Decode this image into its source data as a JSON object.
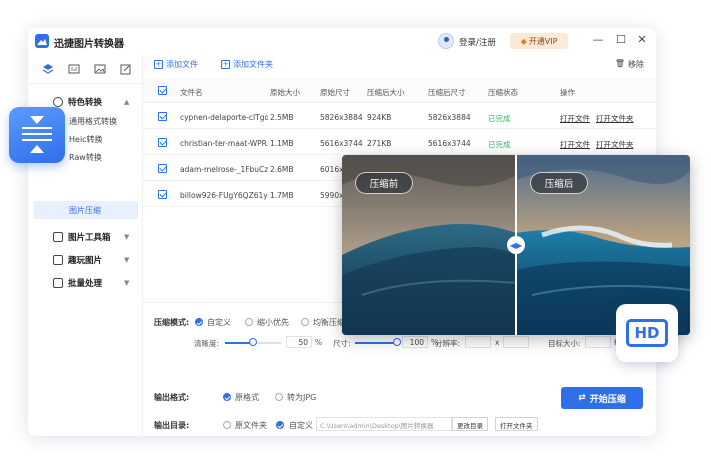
{
  "app": {
    "title": "迅捷图片转换器",
    "login": "登录/注册",
    "vip": "开通VIP",
    "controls": [
      "—",
      "☐",
      "✕"
    ]
  },
  "sidebar": {
    "groups": [
      {
        "label": "特色转换",
        "chevron": "▲"
      },
      {
        "label": "图片工具箱",
        "chevron": "▼"
      },
      {
        "label": "趣玩图片",
        "chevron": "▼"
      },
      {
        "label": "批量处理",
        "chevron": "▼"
      }
    ],
    "sub_items": [
      "通用格式转换",
      "Heic转换",
      "Raw转换"
    ],
    "active_item": "图片压缩"
  },
  "toolbar": {
    "add_file": "添加文件",
    "add_folder": "添加文件夹",
    "remove": "移除"
  },
  "table": {
    "headers": [
      "文件名",
      "原始大小",
      "原始尺寸",
      "压缩后大小",
      "压缩后尺寸",
      "压缩状态",
      "操作"
    ],
    "rows": [
      {
        "name": "cypnen-delaporte-clTgqi...",
        "size": "2.5MB",
        "dim": "5826x3884",
        "csize": "924KB",
        "cdim": "5826x3884",
        "status": "已完成",
        "open_file": "打开文件",
        "open_folder": "打开文件夹"
      },
      {
        "name": "christian-ter-maat-WPR...",
        "size": "1.1MB",
        "dim": "5616x3744",
        "csize": "271KB",
        "cdim": "5616x3744",
        "status": "已完成",
        "open_file": "打开文件",
        "open_folder": "打开文件夹"
      },
      {
        "name": "adam-melrose-_1FbuCzl...",
        "size": "2.6MB",
        "dim": "6016x",
        "csize": "",
        "cdim": "",
        "status": "",
        "open_file": "",
        "open_folder": ""
      },
      {
        "name": "billow926-FUgY6QZ61y0...",
        "size": "1.7MB",
        "dim": "5990x",
        "csize": "",
        "cdim": "",
        "status": "",
        "open_file": "",
        "open_folder": ""
      }
    ]
  },
  "settings": {
    "mode_label": "压缩模式:",
    "mode_options": [
      "自定义",
      "缩小优先",
      "均衡压缩"
    ],
    "clarity_label": "清晰度:",
    "clarity_value": "50",
    "clarity_unit": "%",
    "clarity_fraction": 0.5,
    "size_label": "尺寸:",
    "size_value": "100",
    "size_unit": "%",
    "size_fraction": 1.0,
    "resolution_label": "分辨率:",
    "resolution_sep": "x",
    "target_label": "目标大小:",
    "target_unit": "KB",
    "format_label": "输出格式:",
    "format_options": [
      "原格式",
      "转为JPG"
    ],
    "dir_label": "输出目录:",
    "dir_options": [
      "原文件夹",
      "自定义"
    ],
    "dir_path": "C:\\Users\\admin\\Desktop\\图片转换器",
    "change_dir": "更改目录",
    "open_folder": "打开文件夹",
    "start": "开始压缩"
  },
  "compare": {
    "before": "压缩前",
    "after": "压缩后",
    "handle": "◀▶"
  },
  "badge": {
    "text": "HD"
  },
  "colors": {
    "accent": "#2f6fe8",
    "done": "#3db16e",
    "vip_bg": "#fde9d6"
  }
}
